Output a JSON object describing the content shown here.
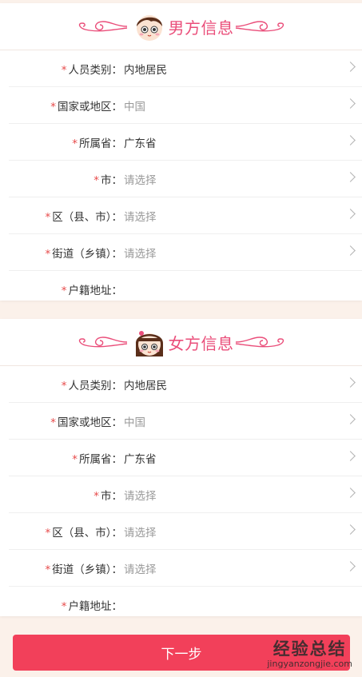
{
  "male": {
    "title": "男方信息",
    "rows": [
      {
        "label": "人员类别：",
        "value": "内地居民",
        "placeholder": false,
        "chevron": true
      },
      {
        "label": "国家或地区：",
        "value": "中国",
        "placeholder": true,
        "chevron": true
      },
      {
        "label": "所属省：",
        "value": "广东省",
        "placeholder": false,
        "chevron": true
      },
      {
        "label": "市：",
        "value": "请选择",
        "placeholder": true,
        "chevron": true
      },
      {
        "label": "区（县、市）：",
        "value": "请选择",
        "placeholder": true,
        "chevron": true
      },
      {
        "label": "街道（乡镇）：",
        "value": "请选择",
        "placeholder": true,
        "chevron": true
      },
      {
        "label": "户籍地址：",
        "value": "",
        "placeholder": true,
        "chevron": false
      }
    ]
  },
  "female": {
    "title": "女方信息",
    "rows": [
      {
        "label": "人员类别：",
        "value": "内地居民",
        "placeholder": false,
        "chevron": true
      },
      {
        "label": "国家或地区：",
        "value": "中国",
        "placeholder": true,
        "chevron": true
      },
      {
        "label": "所属省：",
        "value": "广东省",
        "placeholder": false,
        "chevron": true
      },
      {
        "label": "市：",
        "value": "请选择",
        "placeholder": true,
        "chevron": true
      },
      {
        "label": "区（县、市）：",
        "value": "请选择",
        "placeholder": true,
        "chevron": true
      },
      {
        "label": "街道（乡镇）：",
        "value": "请选择",
        "placeholder": true,
        "chevron": true
      },
      {
        "label": "户籍地址：",
        "value": "",
        "placeholder": true,
        "chevron": false
      }
    ]
  },
  "required_mark": "*",
  "next_button": "下一步",
  "watermark": {
    "cn": "经验总结",
    "en": "jingyanzongjie.com"
  },
  "colors": {
    "accent": "#ea4e7a",
    "button": "#f2405a",
    "required": "#e74a4a",
    "page_bg": "#fbf1ea"
  },
  "icons": {
    "male_avatar": "boy-avatar-icon",
    "female_avatar": "girl-avatar-icon",
    "flourish": "decorative-flourish",
    "chevron": "chevron-right-icon"
  }
}
